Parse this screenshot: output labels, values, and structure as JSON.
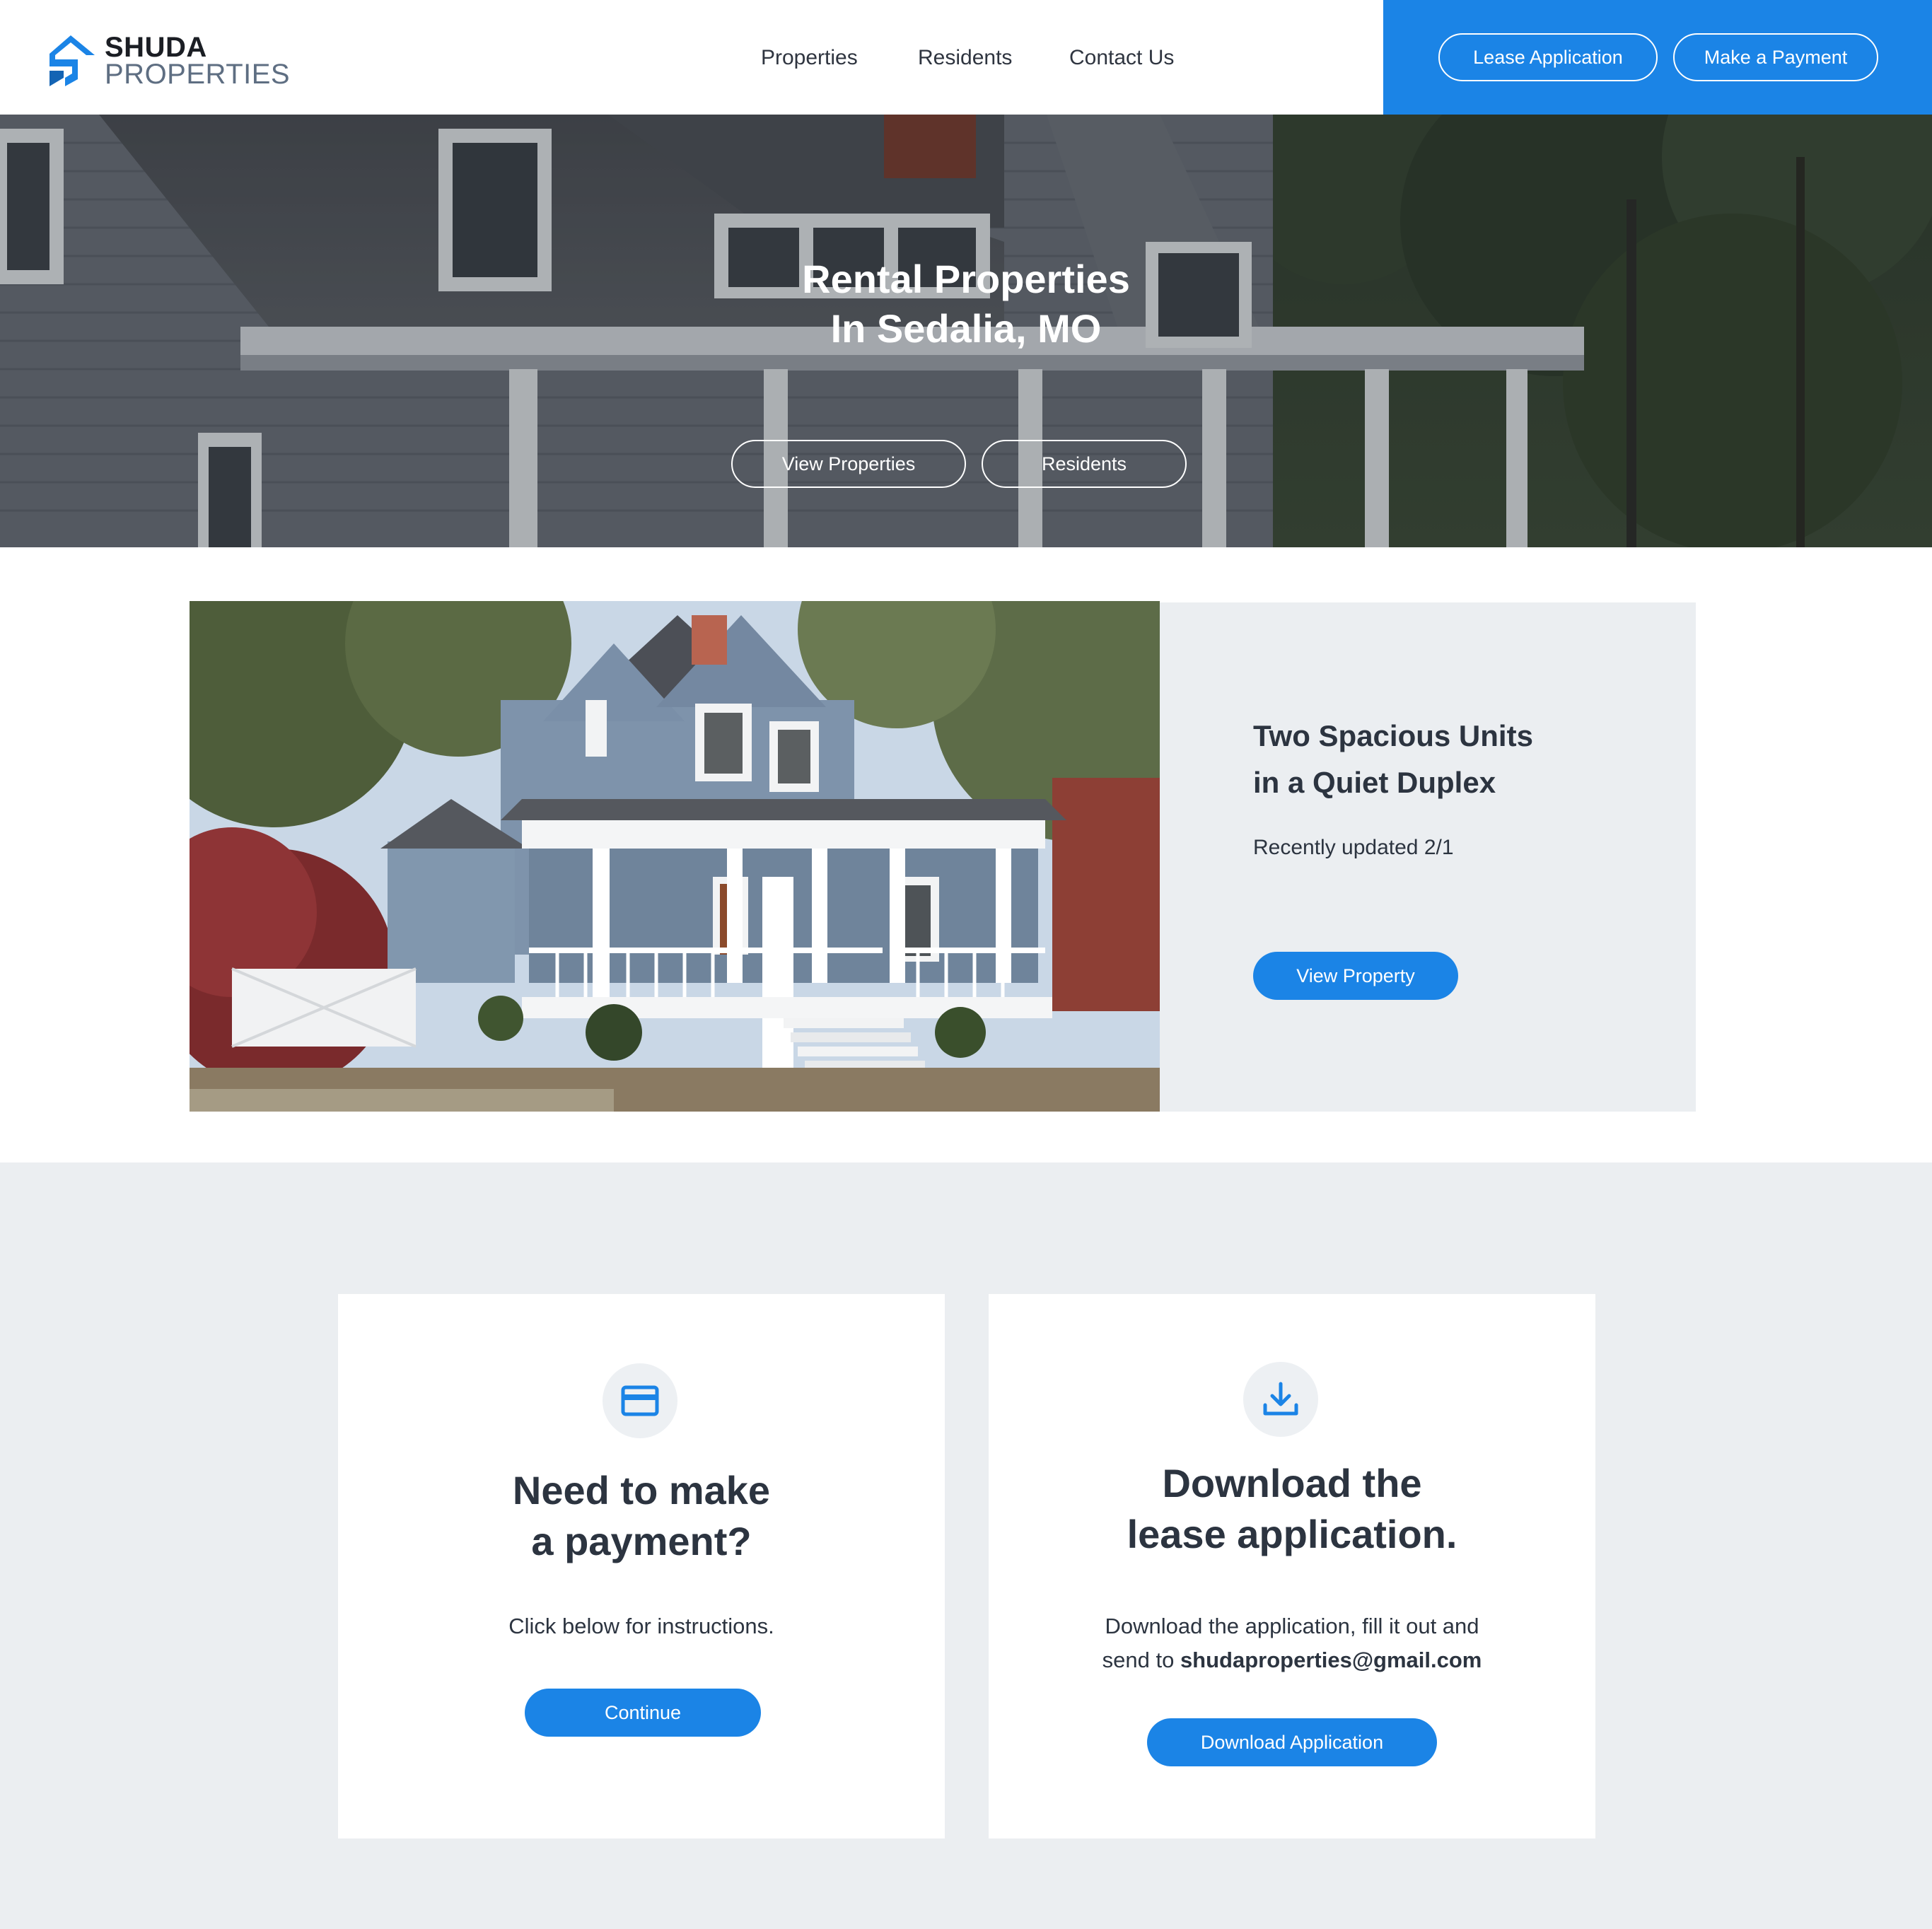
{
  "brand": {
    "name_line1": "SHUDA",
    "name_line2": "PROPERTIES",
    "primary_color": "#1b84e6",
    "icon": "logo-mark-icon"
  },
  "nav": {
    "items": [
      {
        "label": "Properties"
      },
      {
        "label": "Residents"
      },
      {
        "label": "Contact Us"
      }
    ]
  },
  "header_actions": {
    "lease_label": "Lease Application",
    "payment_label": "Make a Payment"
  },
  "hero": {
    "title_line1": "Rental Properties",
    "title_line2": "In Sedalia, MO",
    "view_properties_label": "View Properties",
    "residents_label": "Residents"
  },
  "feature": {
    "heading_line1": "Two Spacious Units",
    "heading_line2": "in a Quiet Duplex",
    "subtext": "Recently updated 2/1",
    "button_label": "View Property"
  },
  "cards": {
    "payment": {
      "icon": "credit-card-icon",
      "title_line1": "Need to make",
      "title_line2": "a payment?",
      "text": "Click below for instructions.",
      "button_label": "Continue"
    },
    "lease": {
      "icon": "download-icon",
      "title_line1": "Download the",
      "title_line2": "lease application.",
      "text_line1": "Download the application, fill it out and",
      "text_line2_prefix": "send to ",
      "email": "shudaproperties@gmail.com",
      "button_label": "Download Application"
    }
  },
  "colors": {
    "section_bg": "#ebeef1",
    "text_dark": "#2c3440"
  }
}
